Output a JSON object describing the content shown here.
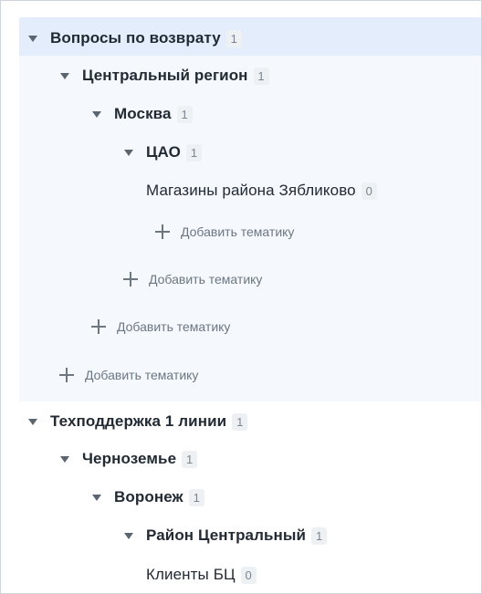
{
  "add_label": "Добавить тематику",
  "tree": {
    "group1": {
      "label": "Вопросы по возврату",
      "count": "1",
      "region": {
        "label": "Центральный регион",
        "count": "1",
        "city": {
          "label": "Москва",
          "count": "1",
          "district": {
            "label": "ЦАО",
            "count": "1",
            "leaf": {
              "label": "Магазины района Зябликово",
              "count": "0"
            }
          }
        }
      }
    },
    "group2": {
      "label": "Техподдержка 1 линии",
      "count": "1",
      "region": {
        "label": "Черноземье",
        "count": "1",
        "city": {
          "label": "Воронеж",
          "count": "1",
          "district": {
            "label": "Район Центральный",
            "count": "1",
            "leaf": {
              "label": "Клиенты БЦ",
              "count": "0"
            }
          }
        }
      }
    }
  }
}
